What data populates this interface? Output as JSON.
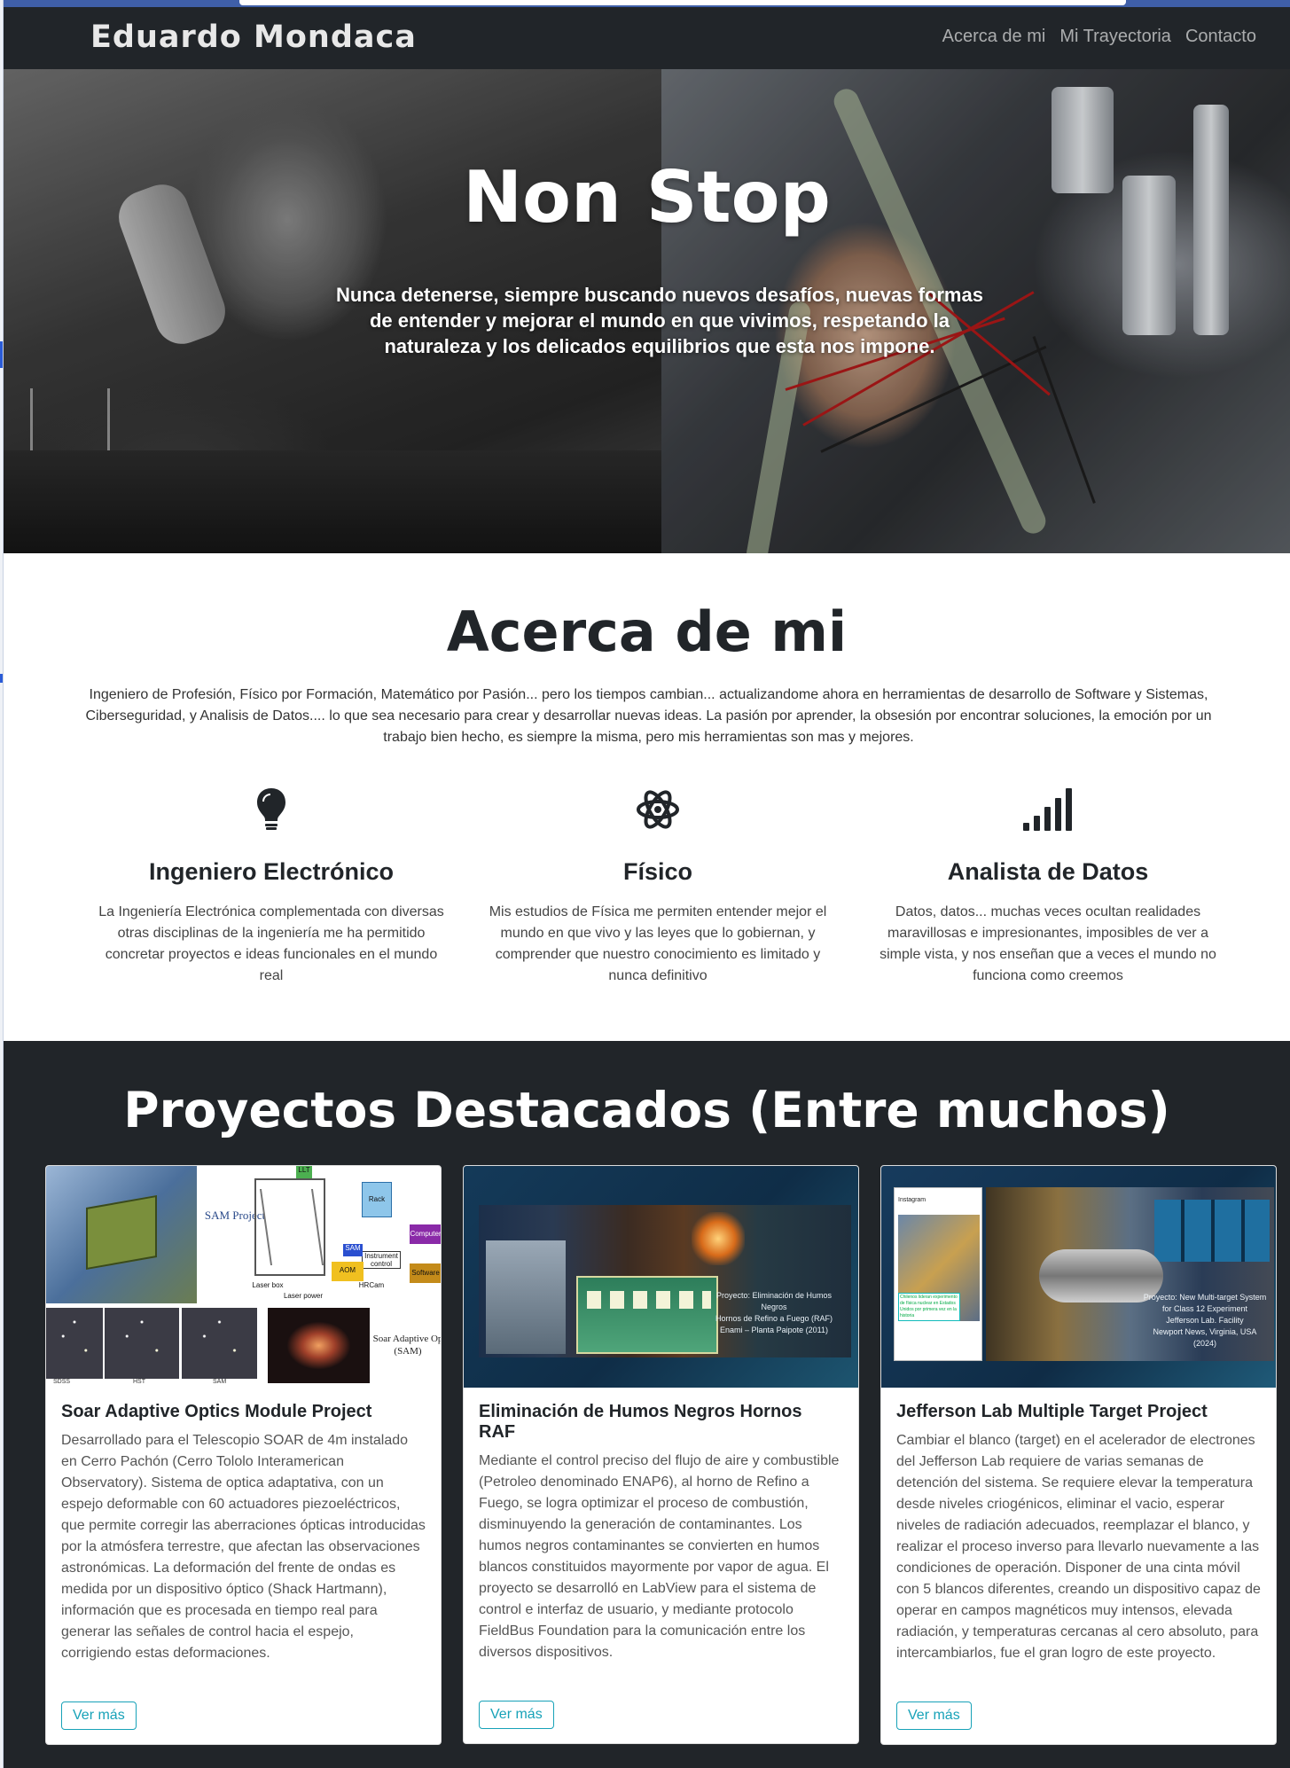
{
  "nav": {
    "brand": "Eduardo Mondaca",
    "links": [
      "Acerca de mi",
      "Mi Trayectoria",
      "Contacto"
    ]
  },
  "hero": {
    "title": "Non Stop",
    "subtitle": "Nunca detenerse, siempre buscando nuevos desafíos, nuevas formas de entender y mejorar el mundo en que vivimos, respetando la naturaleza y los delicados equilibrios que esta nos impone."
  },
  "about": {
    "title": "Acerca de mi",
    "text": "Ingeniero de Profesión, Físico por Formación, Matemático por Pasión... pero los tiempos cambian... actualizandome ahora en herramientas de desarrollo de Software y Sistemas, Ciberseguridad, y Analisis de Datos.... lo que sea necesario para crear y desarrollar nuevas ideas. La pasión por aprender, la obsesión por encontrar soluciones, la emoción por un trabajo bien hecho, es siempre la misma, pero mis herramientas son mas y mejores.",
    "features": [
      {
        "icon": "lightbulb-icon",
        "title": "Ingeniero Electrónico",
        "text": "La Ingeniería Electrónica complementada con diversas otras disciplinas de la ingeniería me ha permitido concretar proyectos e ideas funcionales en el mundo real"
      },
      {
        "icon": "atom-icon",
        "title": "Físico",
        "text": "Mis estudios de Física me permiten entender mejor el mundo en que vivo y las leyes que lo gobiernan, y comprender que nuestro conocimiento es limitado y nunca definitivo"
      },
      {
        "icon": "signal-bars-icon",
        "title": "Analista de Datos",
        "text": "Datos, datos... muchas veces ocultan realidades maravillosas e impresionantes, imposibles de ver a simple vista, y nos enseñan que a veces el mundo no funciona como creemos"
      }
    ]
  },
  "projects": {
    "title": "Proyectos Destacados (Entre muchos)",
    "button_label": "Ver más",
    "cards": [
      {
        "title": "Soar Adaptive Optics Module Project",
        "text": "Desarrollado para el Telescopio SOAR de 4m instalado en Cerro Pachón (Cerro Tololo Interamerican Observatory). Sistema de optica adaptativa, con un espejo deformable con 60 actuadores piezoeléctricos, que permite corregir las aberraciones ópticas introducidas por la atmósfera terrestre, que afectan las observaciones astronómicas. La deformación del frente de ondas es medida por un dispositivo óptico (Shack Hartmann), información que es procesada en tiempo real para generar las señales de control hacia el espejo, corrigiendo estas deformaciones.",
        "image_labels": {
          "sam": "SAM Project",
          "llt": "LLT",
          "rack": "Rack",
          "computer": "Computer",
          "software": "Software",
          "instrument": "Instrument control",
          "sam_block": "SAM",
          "aom": "AOM",
          "hrcam": "HRCam",
          "laser_box": "Laser box",
          "laser_power": "Laser power",
          "sdss": "SDSS",
          "hst": "HST",
          "sam_small": "SAM",
          "soar": "Soar Adaptive Op (SAM)"
        }
      },
      {
        "title": "Eliminación de Humos Negros Hornos RAF",
        "text": "Mediante el control preciso del flujo de aire y combustible (Petroleo denominado ENAP6), al horno de Refino a Fuego, se logra optimizar el proceso de combustión, disminuyendo la generación de contaminantes. Los humos negros contaminantes se convierten en humos blancos constituidos mayormente por vapor de agua. El proyecto se desarrolló en LabView para el sistema de control e interfaz de usuario, y mediante protocolo FieldBus Foundation para la comunicación entre los diversos dispositivos.",
        "image_caption": [
          "Proyecto: Eliminación de Humos",
          "Negros",
          "Hornos de Refino a Fuego (RAF)",
          "Enami – Planta Paipote (2011)"
        ]
      },
      {
        "title": "Jefferson Lab Multiple Target Project",
        "text": "Cambiar el blanco (target) en el acelerador de electrones del Jefferson Lab requiere de varias semanas de detención del sistema. Se requiere elevar la temperatura desde niveles criogénicos, eliminar el vacio, esperar niveles de radiación adecuados, reemplazar el blanco, y realizar el proceso inverso para llevarlo nuevamente a las condiciones de operación. Disponer de una cinta móvil con 5 blancos diferentes, creando un dispositivo capaz de operar en campos magnéticos muy intensos, elevada radiación, y temperaturas cercanas al cero absoluto, para intercambiarlos, fue el gran logro de este proyecto.",
        "image_caption": [
          "Proyecto: New Multi-target System",
          "for Class 12 Experiment",
          "Jefferson Lab. Facility",
          "Newport News, Virginia, USA",
          "(2024)"
        ],
        "image_phone": {
          "app": "Instagram",
          "headline": "Chilenos lideran experimento de física nuclear en Estados Unidos por primera vez en la historia"
        }
      }
    ]
  },
  "colors": {
    "navbar": "#212529",
    "projects_bg": "#212529",
    "button": "#17a2b8"
  }
}
